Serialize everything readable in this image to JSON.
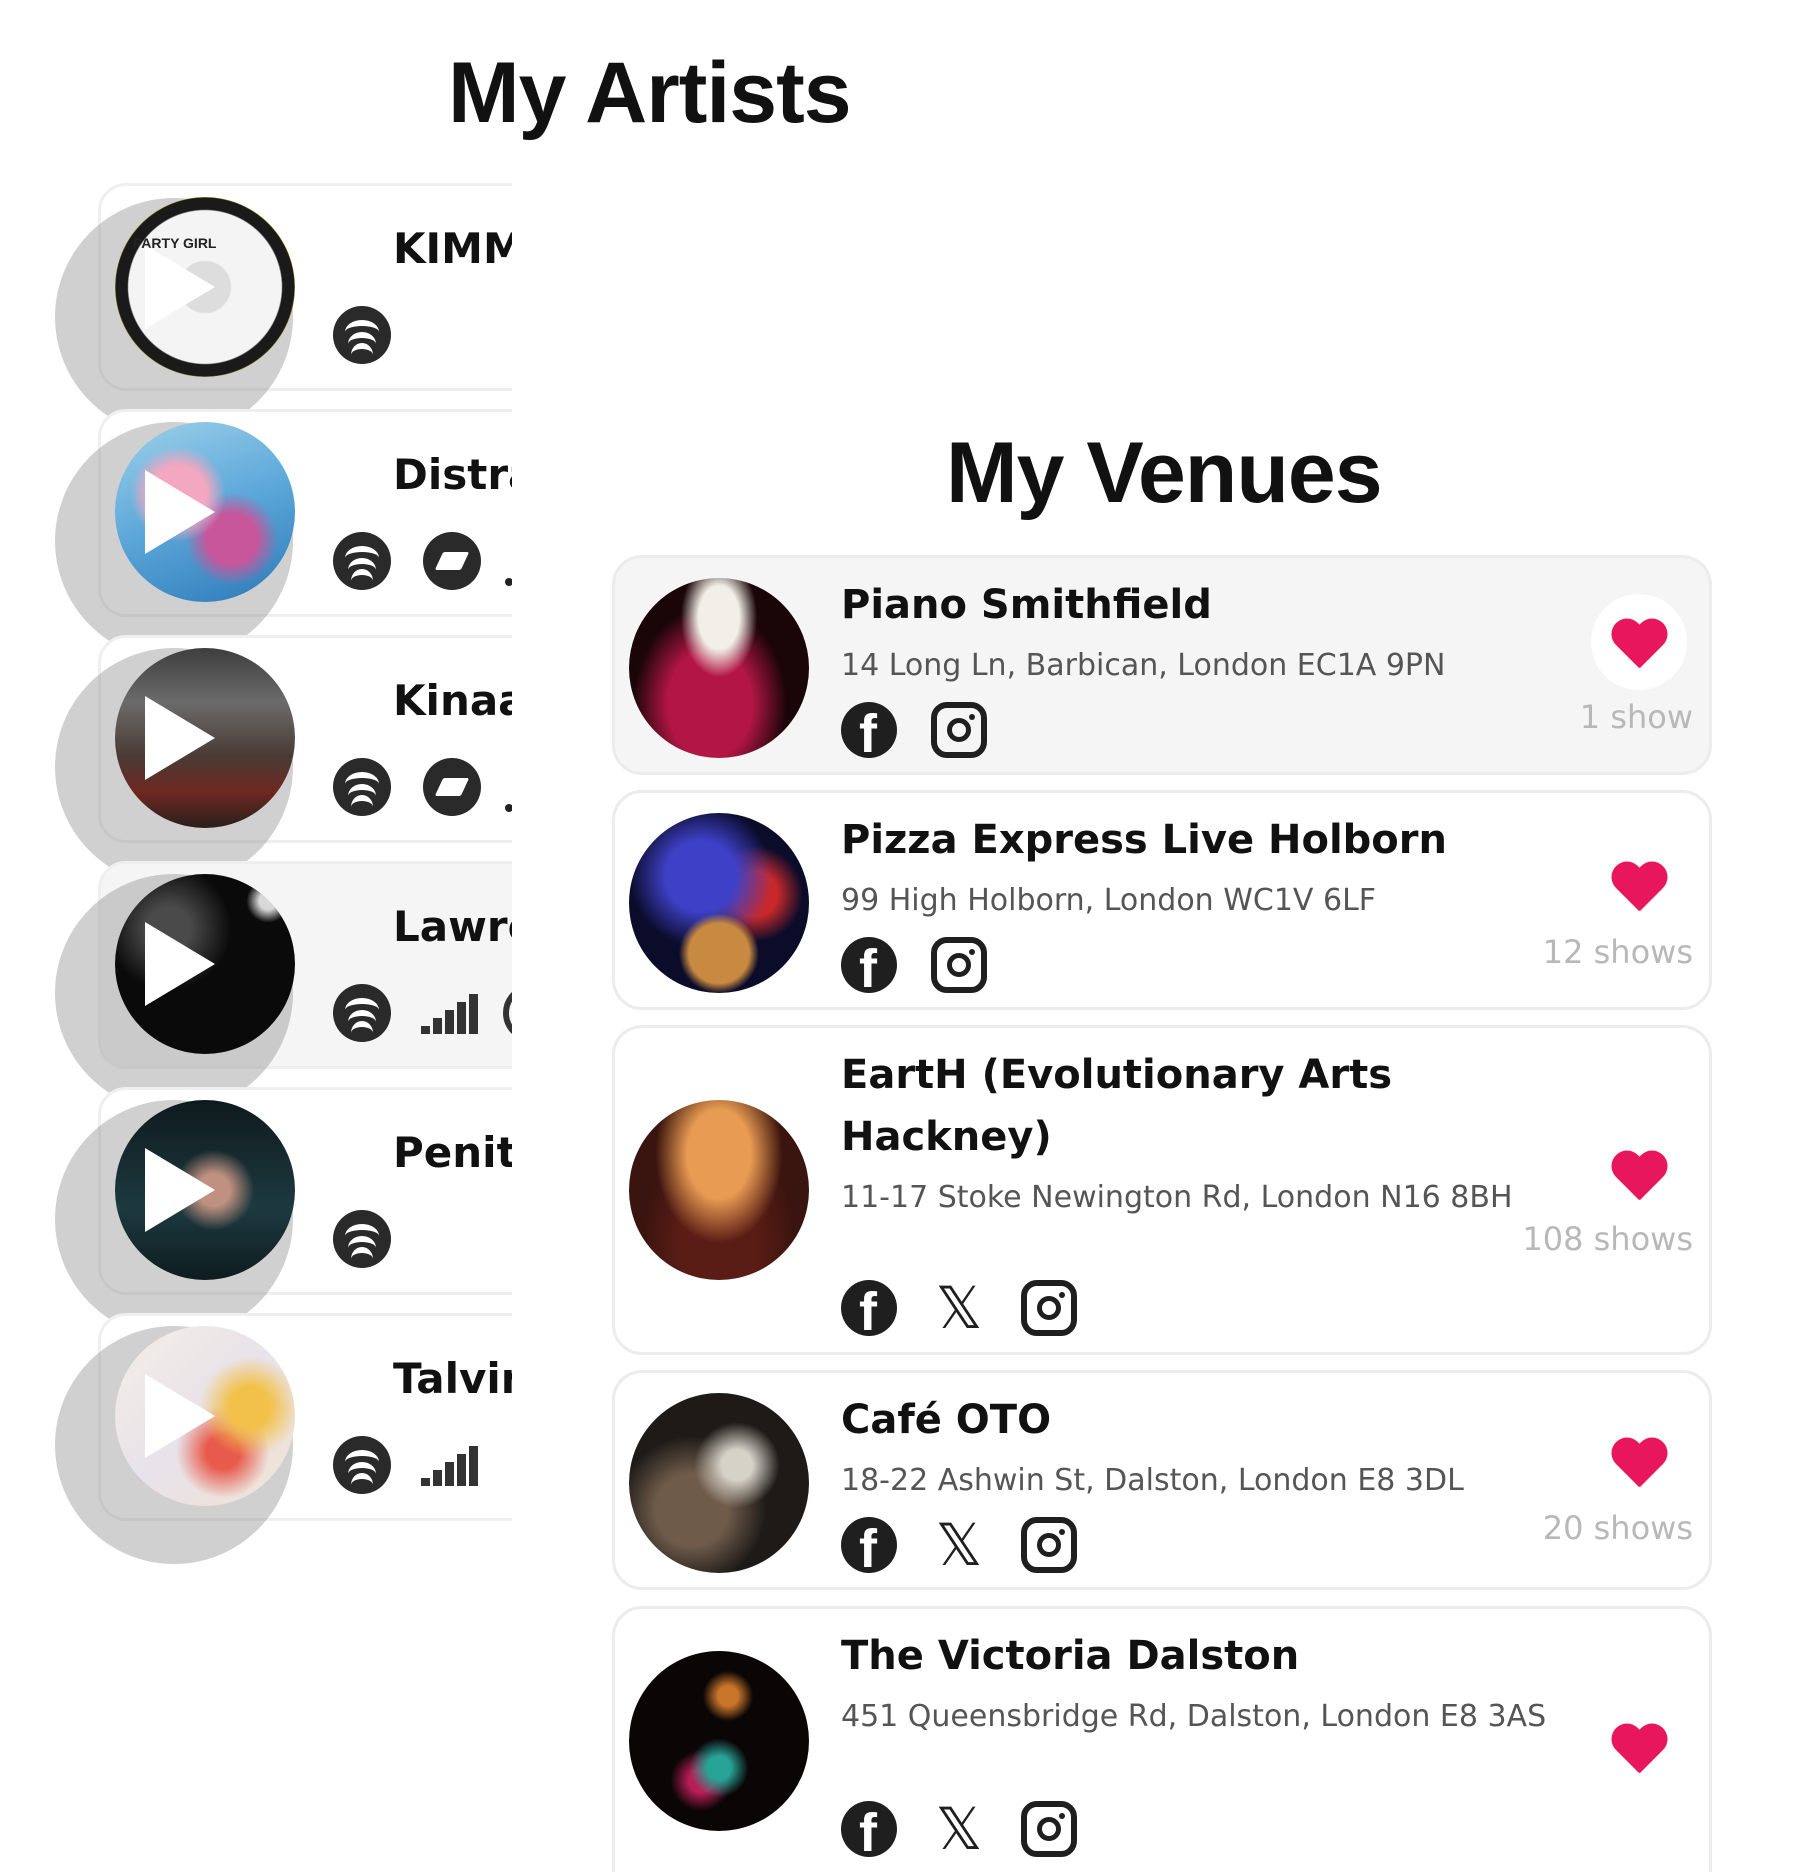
{
  "artists_section": {
    "title": "My Artists",
    "items": [
      {
        "name": "KIMMIC",
        "art_label": "PARTY GIRL",
        "services": [
          "spotify-icon"
        ]
      },
      {
        "name": "Distract",
        "services": [
          "spotify-icon",
          "tidal-icon"
        ]
      },
      {
        "name": "Kinaara",
        "services": [
          "spotify-icon",
          "tidal-icon"
        ]
      },
      {
        "name": "Lawrenc",
        "services": [
          "spotify-icon",
          "deezer-icon"
        ]
      },
      {
        "name": "Penitenc",
        "services": [
          "spotify-icon"
        ]
      },
      {
        "name": "Talvin Si",
        "services": [
          "spotify-icon",
          "deezer-icon"
        ]
      }
    ]
  },
  "venues_section": {
    "title": "My Venues",
    "items": [
      {
        "name": "Piano Smithfield",
        "address": "14 Long Ln, Barbican, London EC1A 9PN",
        "shows": "1 show",
        "socials": [
          "facebook-icon",
          "instagram-icon"
        ]
      },
      {
        "name": "Pizza Express Live Holborn",
        "address": "99 High Holborn, London WC1V 6LF",
        "shows": "12 shows",
        "socials": [
          "facebook-icon",
          "instagram-icon"
        ]
      },
      {
        "name": "EartH (Evolutionary Arts Hackney)",
        "address": "11-17 Stoke Newington Rd, London N16 8BH",
        "shows": "108 shows",
        "socials": [
          "facebook-icon",
          "x-icon",
          "instagram-icon"
        ]
      },
      {
        "name": "Café OTO",
        "address": "18-22 Ashwin St, Dalston, London E8 3DL",
        "shows": "20 shows",
        "socials": [
          "facebook-icon",
          "x-icon",
          "instagram-icon"
        ]
      },
      {
        "name": "The Victoria Dalston",
        "address": "451 Queensbridge Rd, Dalston, London E8 3AS",
        "shows": "",
        "socials": [
          "facebook-icon",
          "x-icon",
          "instagram-icon"
        ]
      }
    ]
  },
  "colors": {
    "accent": "#e8175d",
    "muted_text": "#b8b8b8"
  }
}
